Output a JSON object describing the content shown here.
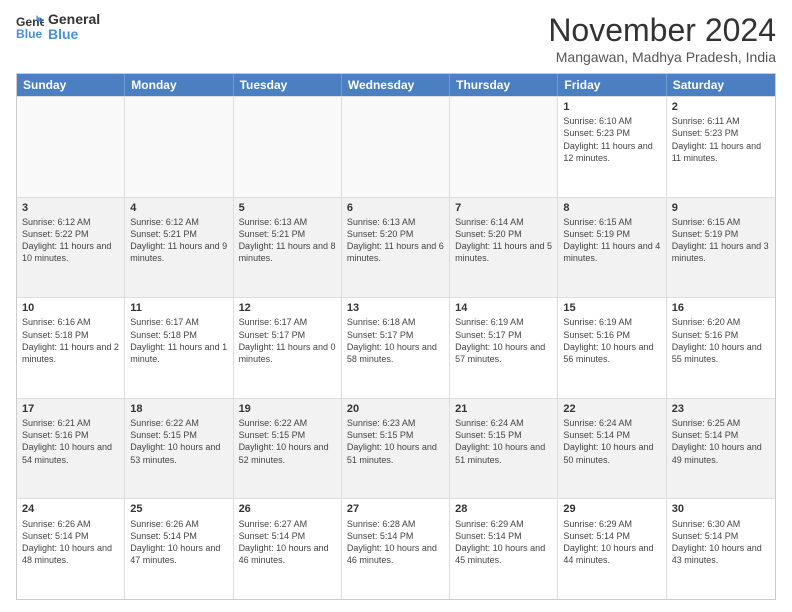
{
  "header": {
    "logo_line1": "General",
    "logo_line2": "Blue",
    "month_title": "November 2024",
    "location": "Mangawan, Madhya Pradesh, India"
  },
  "days_of_week": [
    "Sunday",
    "Monday",
    "Tuesday",
    "Wednesday",
    "Thursday",
    "Friday",
    "Saturday"
  ],
  "rows": [
    [
      {
        "day": "",
        "info": ""
      },
      {
        "day": "",
        "info": ""
      },
      {
        "day": "",
        "info": ""
      },
      {
        "day": "",
        "info": ""
      },
      {
        "day": "",
        "info": ""
      },
      {
        "day": "1",
        "info": "Sunrise: 6:10 AM\nSunset: 5:23 PM\nDaylight: 11 hours and 12 minutes."
      },
      {
        "day": "2",
        "info": "Sunrise: 6:11 AM\nSunset: 5:23 PM\nDaylight: 11 hours and 11 minutes."
      }
    ],
    [
      {
        "day": "3",
        "info": "Sunrise: 6:12 AM\nSunset: 5:22 PM\nDaylight: 11 hours and 10 minutes."
      },
      {
        "day": "4",
        "info": "Sunrise: 6:12 AM\nSunset: 5:21 PM\nDaylight: 11 hours and 9 minutes."
      },
      {
        "day": "5",
        "info": "Sunrise: 6:13 AM\nSunset: 5:21 PM\nDaylight: 11 hours and 8 minutes."
      },
      {
        "day": "6",
        "info": "Sunrise: 6:13 AM\nSunset: 5:20 PM\nDaylight: 11 hours and 6 minutes."
      },
      {
        "day": "7",
        "info": "Sunrise: 6:14 AM\nSunset: 5:20 PM\nDaylight: 11 hours and 5 minutes."
      },
      {
        "day": "8",
        "info": "Sunrise: 6:15 AM\nSunset: 5:19 PM\nDaylight: 11 hours and 4 minutes."
      },
      {
        "day": "9",
        "info": "Sunrise: 6:15 AM\nSunset: 5:19 PM\nDaylight: 11 hours and 3 minutes."
      }
    ],
    [
      {
        "day": "10",
        "info": "Sunrise: 6:16 AM\nSunset: 5:18 PM\nDaylight: 11 hours and 2 minutes."
      },
      {
        "day": "11",
        "info": "Sunrise: 6:17 AM\nSunset: 5:18 PM\nDaylight: 11 hours and 1 minute."
      },
      {
        "day": "12",
        "info": "Sunrise: 6:17 AM\nSunset: 5:17 PM\nDaylight: 11 hours and 0 minutes."
      },
      {
        "day": "13",
        "info": "Sunrise: 6:18 AM\nSunset: 5:17 PM\nDaylight: 10 hours and 58 minutes."
      },
      {
        "day": "14",
        "info": "Sunrise: 6:19 AM\nSunset: 5:17 PM\nDaylight: 10 hours and 57 minutes."
      },
      {
        "day": "15",
        "info": "Sunrise: 6:19 AM\nSunset: 5:16 PM\nDaylight: 10 hours and 56 minutes."
      },
      {
        "day": "16",
        "info": "Sunrise: 6:20 AM\nSunset: 5:16 PM\nDaylight: 10 hours and 55 minutes."
      }
    ],
    [
      {
        "day": "17",
        "info": "Sunrise: 6:21 AM\nSunset: 5:16 PM\nDaylight: 10 hours and 54 minutes."
      },
      {
        "day": "18",
        "info": "Sunrise: 6:22 AM\nSunset: 5:15 PM\nDaylight: 10 hours and 53 minutes."
      },
      {
        "day": "19",
        "info": "Sunrise: 6:22 AM\nSunset: 5:15 PM\nDaylight: 10 hours and 52 minutes."
      },
      {
        "day": "20",
        "info": "Sunrise: 6:23 AM\nSunset: 5:15 PM\nDaylight: 10 hours and 51 minutes."
      },
      {
        "day": "21",
        "info": "Sunrise: 6:24 AM\nSunset: 5:15 PM\nDaylight: 10 hours and 51 minutes."
      },
      {
        "day": "22",
        "info": "Sunrise: 6:24 AM\nSunset: 5:14 PM\nDaylight: 10 hours and 50 minutes."
      },
      {
        "day": "23",
        "info": "Sunrise: 6:25 AM\nSunset: 5:14 PM\nDaylight: 10 hours and 49 minutes."
      }
    ],
    [
      {
        "day": "24",
        "info": "Sunrise: 6:26 AM\nSunset: 5:14 PM\nDaylight: 10 hours and 48 minutes."
      },
      {
        "day": "25",
        "info": "Sunrise: 6:26 AM\nSunset: 5:14 PM\nDaylight: 10 hours and 47 minutes."
      },
      {
        "day": "26",
        "info": "Sunrise: 6:27 AM\nSunset: 5:14 PM\nDaylight: 10 hours and 46 minutes."
      },
      {
        "day": "27",
        "info": "Sunrise: 6:28 AM\nSunset: 5:14 PM\nDaylight: 10 hours and 46 minutes."
      },
      {
        "day": "28",
        "info": "Sunrise: 6:29 AM\nSunset: 5:14 PM\nDaylight: 10 hours and 45 minutes."
      },
      {
        "day": "29",
        "info": "Sunrise: 6:29 AM\nSunset: 5:14 PM\nDaylight: 10 hours and 44 minutes."
      },
      {
        "day": "30",
        "info": "Sunrise: 6:30 AM\nSunset: 5:14 PM\nDaylight: 10 hours and 43 minutes."
      }
    ]
  ]
}
